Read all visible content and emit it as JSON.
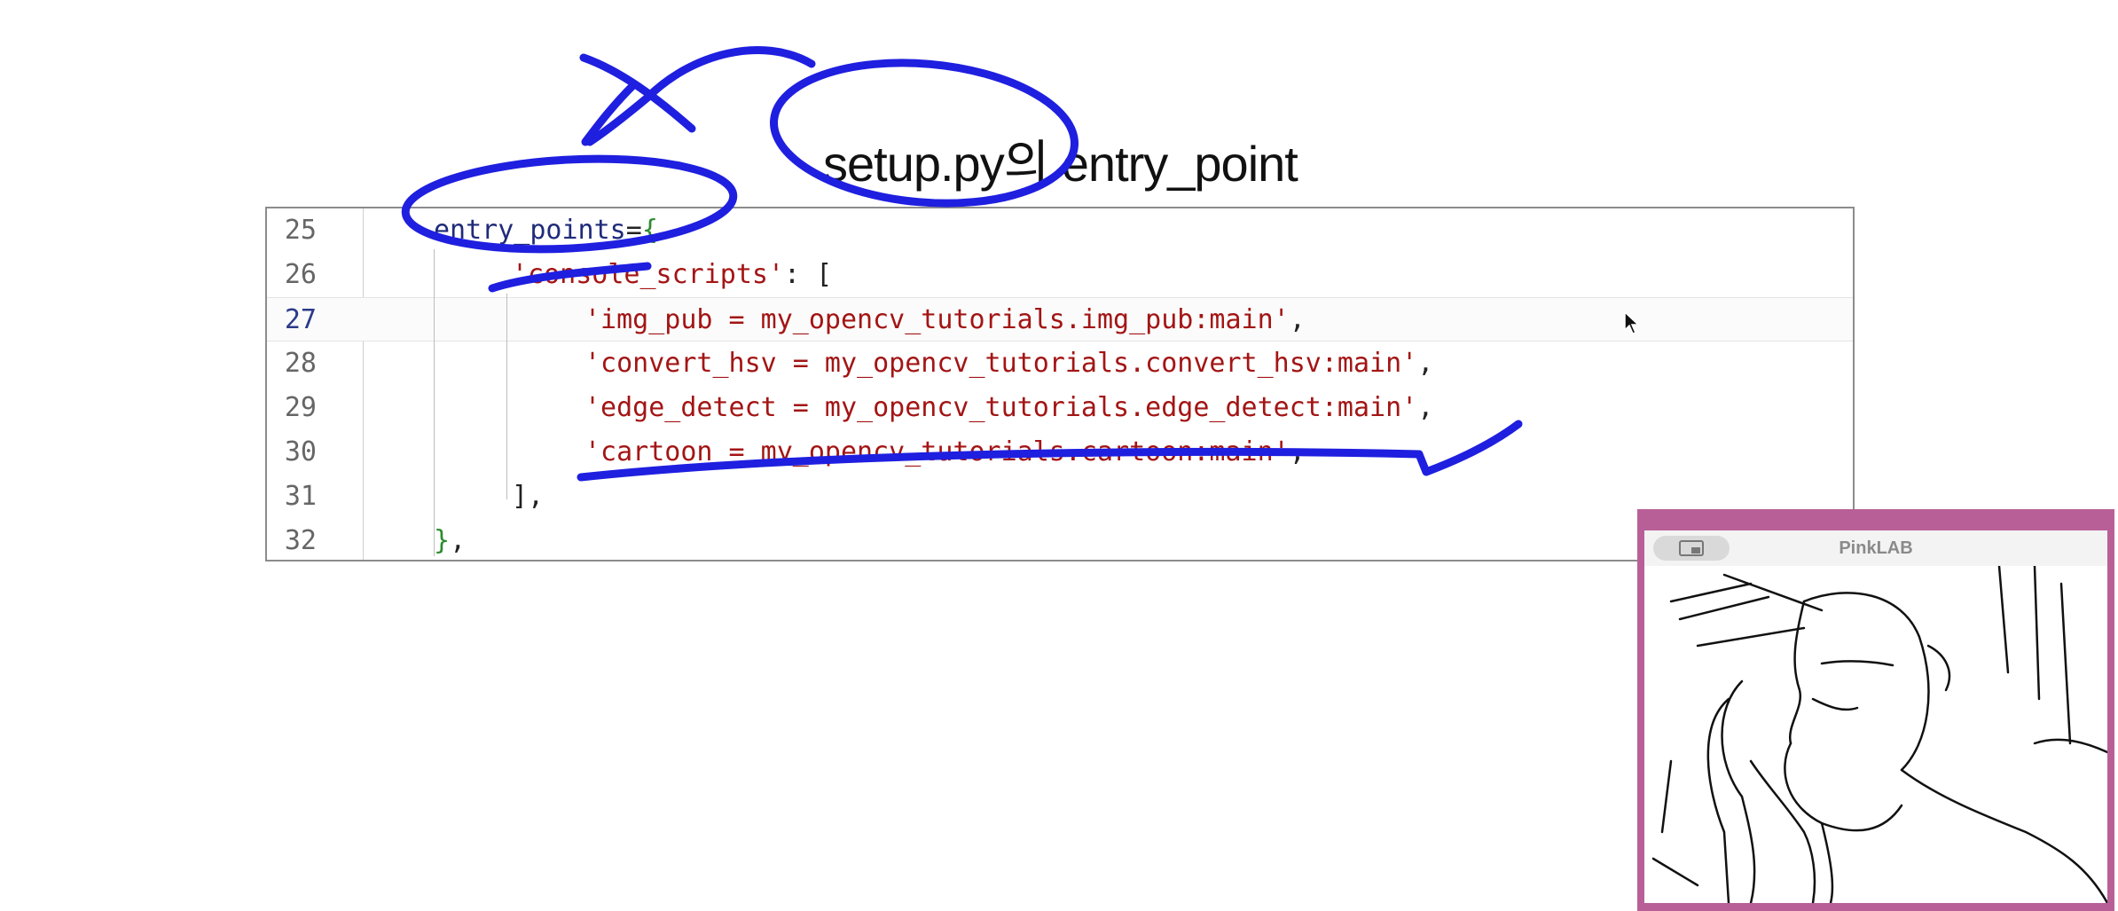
{
  "slide": {
    "title": "setup.py의 entry_point"
  },
  "editor": {
    "current_line": 27,
    "lines": [
      {
        "num": "25",
        "indent": "",
        "parts": [
          [
            "entry_points",
            "c-ident"
          ],
          [
            "=",
            "c-punc"
          ],
          [
            "{",
            "c-brace"
          ]
        ]
      },
      {
        "num": "26",
        "indent": "",
        "parts": [
          [
            "'console_scripts'",
            "c-str"
          ],
          [
            ": [",
            "c-punc"
          ]
        ]
      },
      {
        "num": "27",
        "indent": "",
        "parts": [
          [
            "'img_pub = my_opencv_tutorials.img_pub:main'",
            "c-str"
          ],
          [
            ",",
            "c-punc"
          ]
        ]
      },
      {
        "num": "28",
        "indent": "",
        "parts": [
          [
            "'convert_hsv = my_opencv_tutorials.convert_hsv:main'",
            "c-str"
          ],
          [
            ",",
            "c-punc"
          ]
        ]
      },
      {
        "num": "29",
        "indent": "",
        "parts": [
          [
            "'edge_detect = my_opencv_tutorials.edge_detect:main'",
            "c-str"
          ],
          [
            ",",
            "c-punc"
          ]
        ]
      },
      {
        "num": "30",
        "indent": "",
        "parts": [
          [
            "'cartoon = my_opencv_tutorials.cartoon:main'",
            "c-str"
          ],
          [
            ",",
            "c-punc"
          ]
        ]
      },
      {
        "num": "31",
        "indent": "",
        "parts": [
          [
            "],",
            "c-punc"
          ]
        ]
      },
      {
        "num": "32",
        "indent": "",
        "parts": [
          [
            "}",
            "c-brace"
          ],
          [
            ",",
            "c-punc"
          ]
        ]
      }
    ]
  },
  "webcam": {
    "title": "PinkLAB",
    "toggle_icon": "picture-in-picture-icon"
  },
  "colors": {
    "annotation_pen": "#1f1fe0",
    "webcam_border": "#b95f98",
    "string": "#a31515",
    "identifier": "#1f2b7a",
    "brace": "#2e8b2e"
  }
}
